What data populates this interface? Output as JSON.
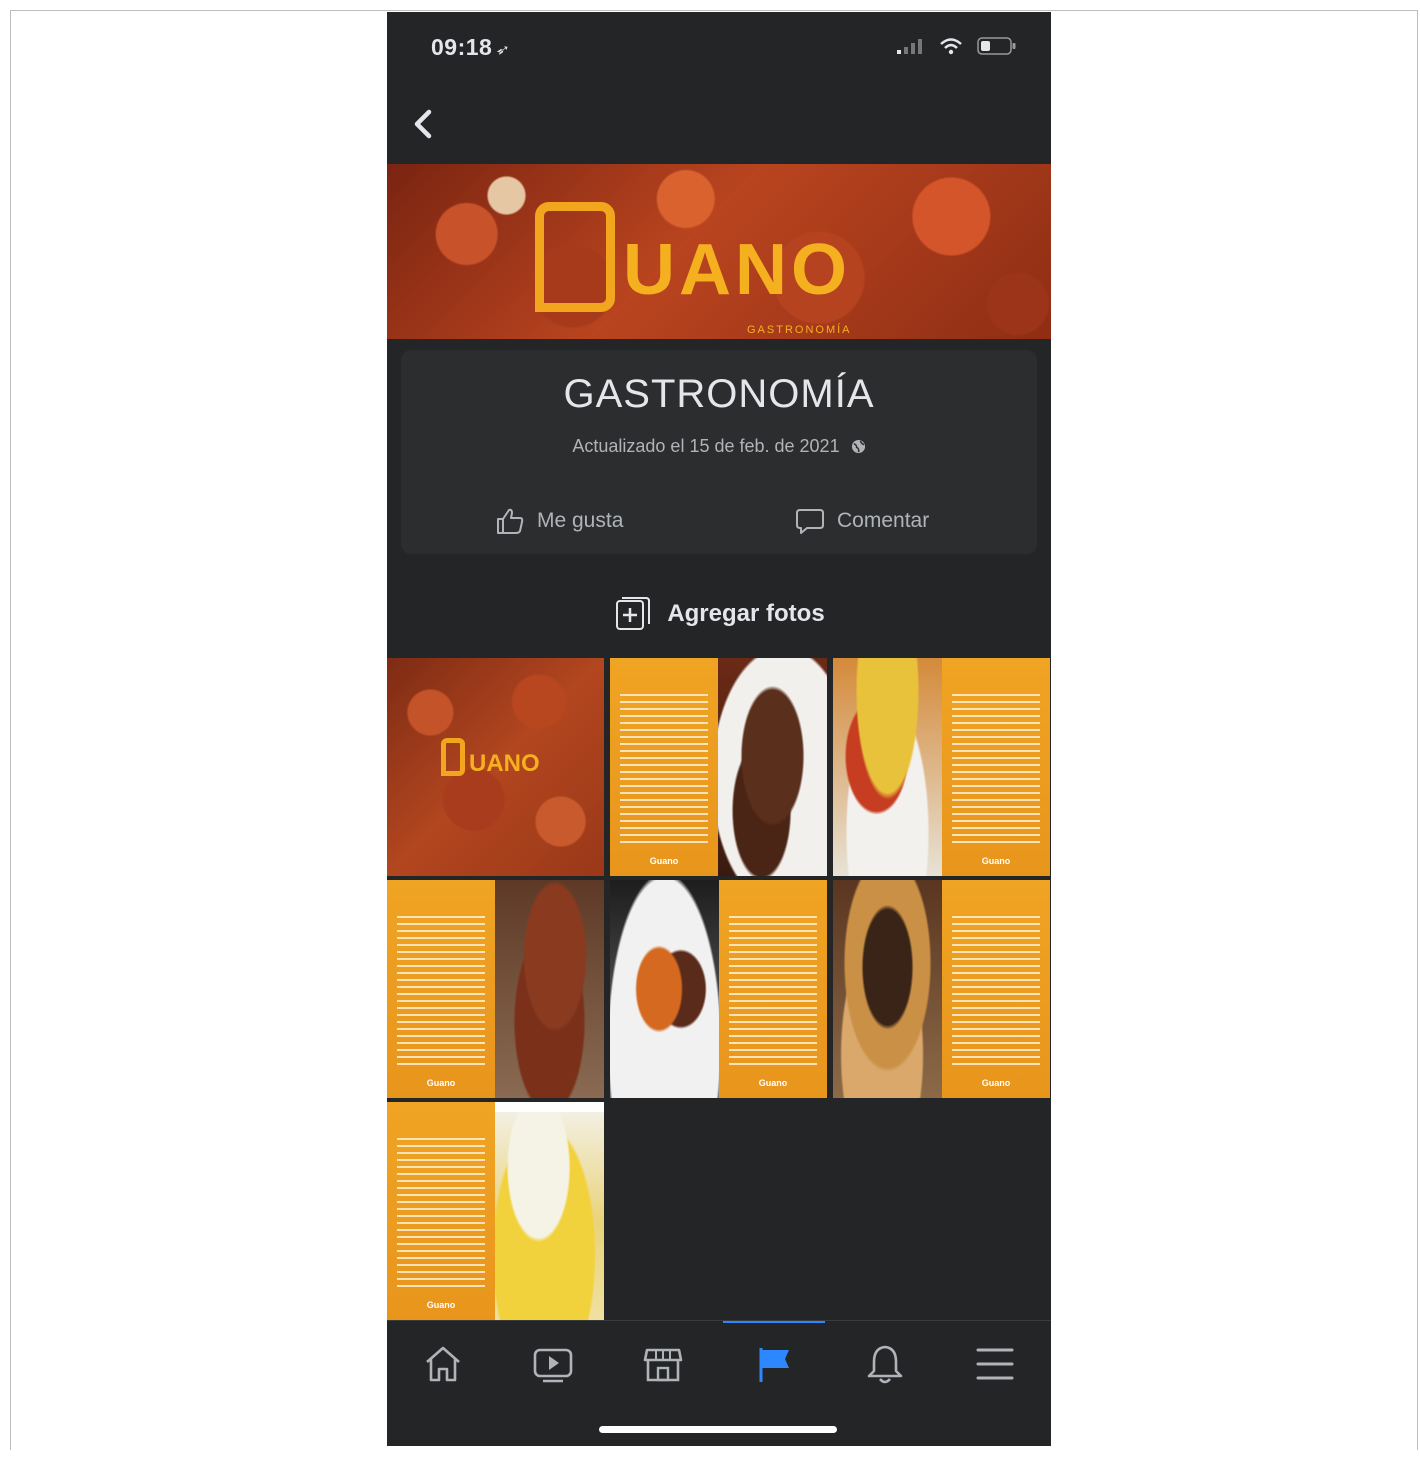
{
  "status_bar": {
    "time": "09:18"
  },
  "cover": {
    "logo_text": "UANO",
    "sub_text": "GASTRONOMÍA"
  },
  "album": {
    "title": "GASTRONOMÍA",
    "updated": "Actualizado el 15 de feb. de 2021"
  },
  "actions": {
    "like_label": "Me gusta",
    "comment_label": "Comentar"
  },
  "add_photos_label": "Agregar fotos",
  "grid": {
    "cover_tile_text": "UANO",
    "tile_brand": "Guano"
  },
  "tabs": [
    "home-icon",
    "video-icon",
    "marketplace-icon",
    "pages-flag-icon",
    "notifications-bell-icon",
    "menu-icon"
  ],
  "colors": {
    "background": "#242526",
    "accent": "#2d88ff",
    "brand_orange": "#f0a423"
  }
}
